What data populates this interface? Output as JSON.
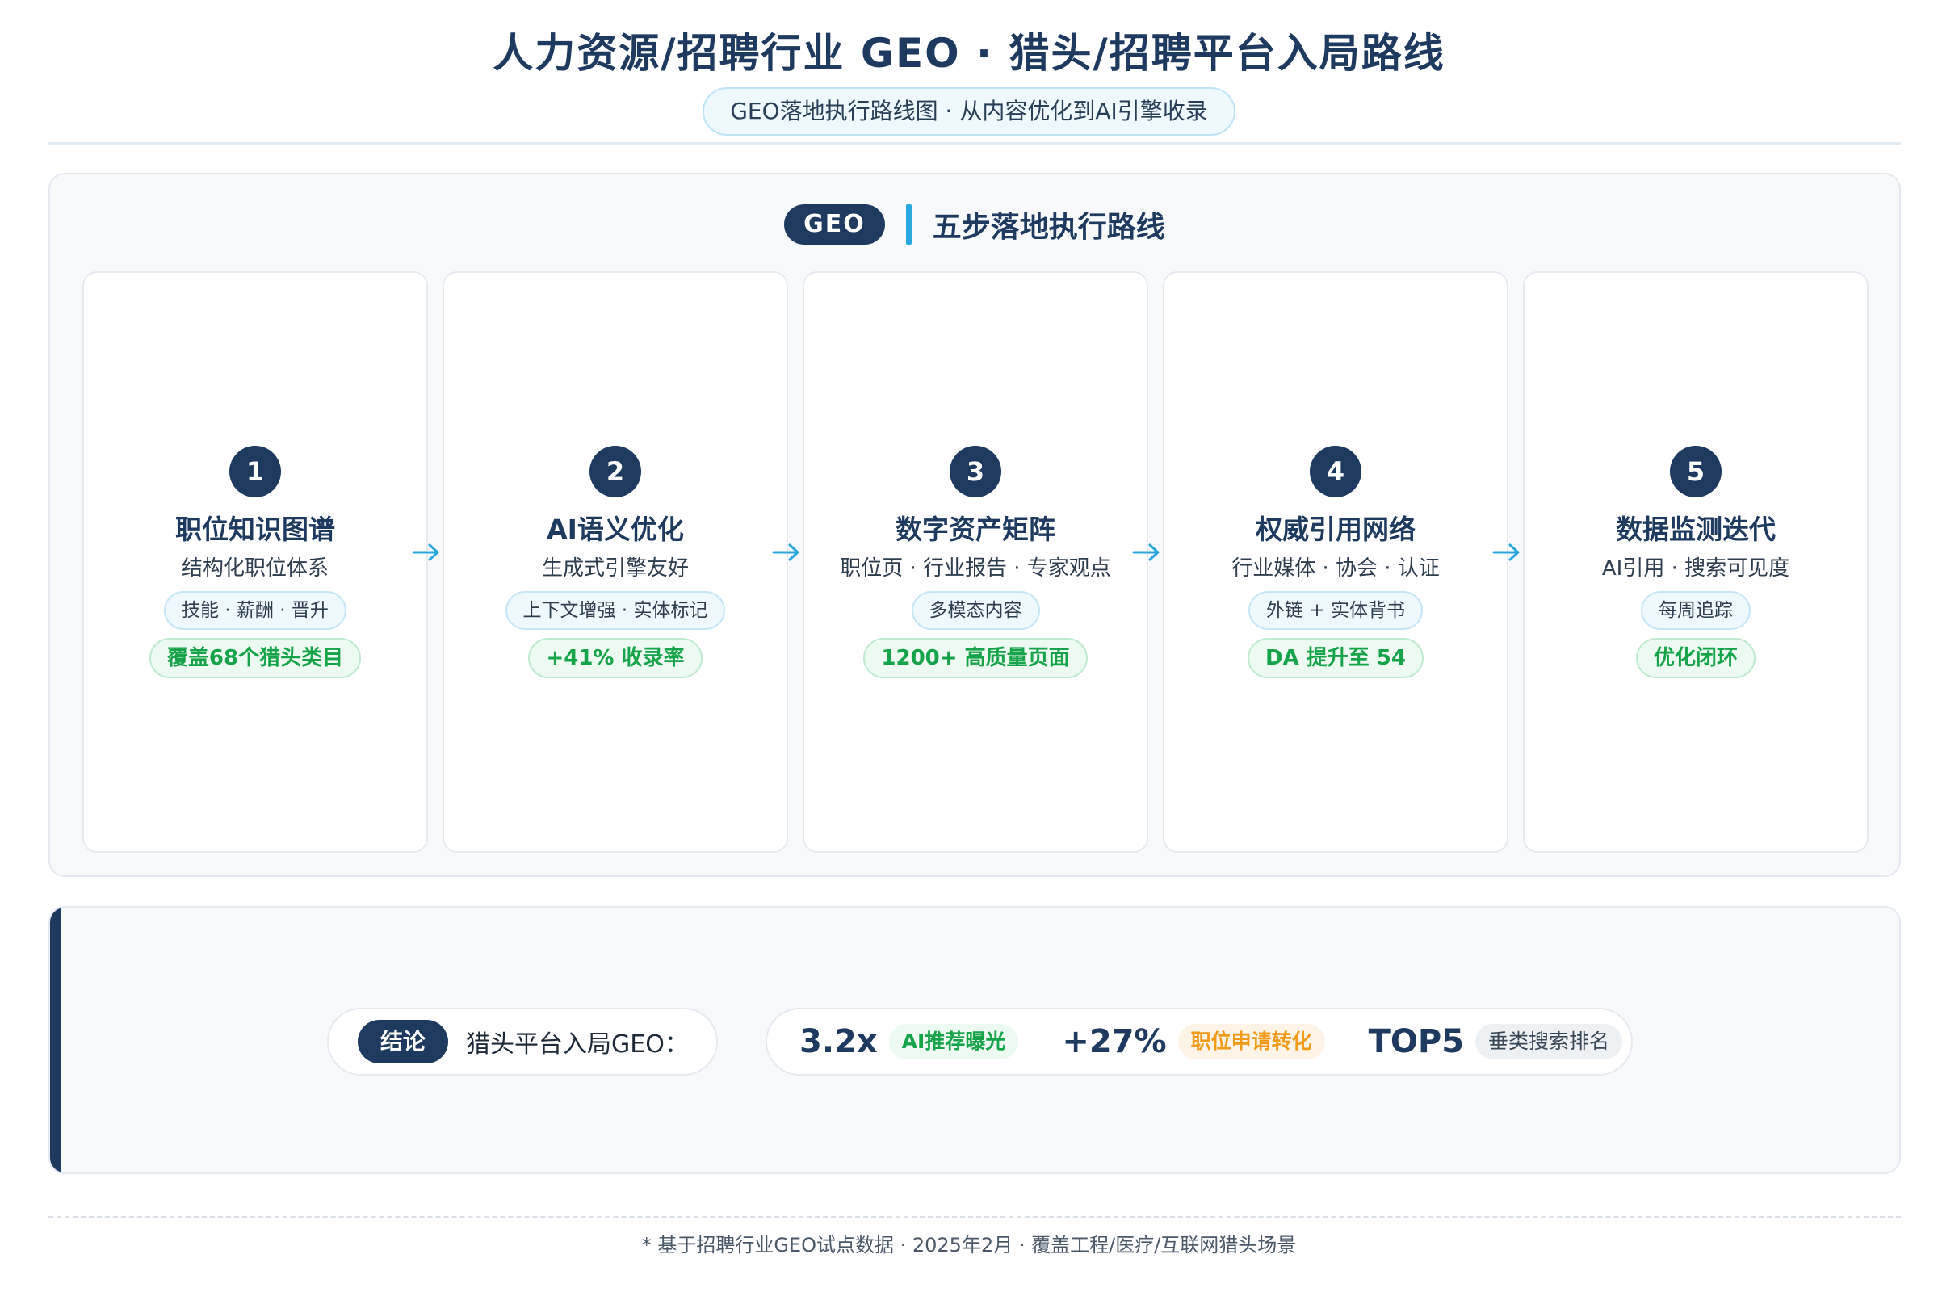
{
  "header": {
    "title": "人力资源/招聘行业 GEO · 猎头/招聘平台入局路线",
    "subtitle": "GEO落地执行路线图 · 从内容优化到AI引擎收录"
  },
  "roadmap": {
    "badge": "GEO",
    "heading": "五步落地执行路线",
    "steps": [
      {
        "num": "1",
        "title": "职位知识图谱",
        "desc": "结构化职位体系",
        "tag": "技能 · 薪酬 · 晋升",
        "metric": "覆盖68个猎头类目"
      },
      {
        "num": "2",
        "title": "AI语义优化",
        "desc": "生成式引擎友好",
        "tag": "上下文增强 · 实体标记",
        "metric": "+41% 收录率"
      },
      {
        "num": "3",
        "title": "数字资产矩阵",
        "desc": "职位页 · 行业报告 · 专家观点",
        "tag": "多模态内容",
        "metric": "1200+ 高质量页面"
      },
      {
        "num": "4",
        "title": "权威引用网络",
        "desc": "行业媒体 · 协会 · 认证",
        "tag": "外链 + 实体背书",
        "metric": "DA 提升至 54"
      },
      {
        "num": "5",
        "title": "数据监测迭代",
        "desc": "AI引用 · 搜索可见度",
        "tag": "每周追踪",
        "metric": "优化闭环"
      }
    ]
  },
  "conclusion": {
    "badge": "结论",
    "text": "猎头平台入局GEO：",
    "stats": [
      {
        "value": "3.2x",
        "label": "AI推荐曝光",
        "color": "green"
      },
      {
        "value": "+27%",
        "label": "职位申请转化",
        "color": "orange"
      },
      {
        "value": "TOP5",
        "label": "垂类搜索排名",
        "color": "gray"
      }
    ]
  },
  "footer": {
    "note": "* 基于招聘行业GEO试点数据 · 2025年2月 · 覆盖工程/医疗/互联网猎头场景"
  },
  "colors": {
    "navy": "#1e3a5f",
    "accent_blue": "#2ba8e0",
    "green": "#17a34a",
    "orange": "#f29a1a"
  }
}
